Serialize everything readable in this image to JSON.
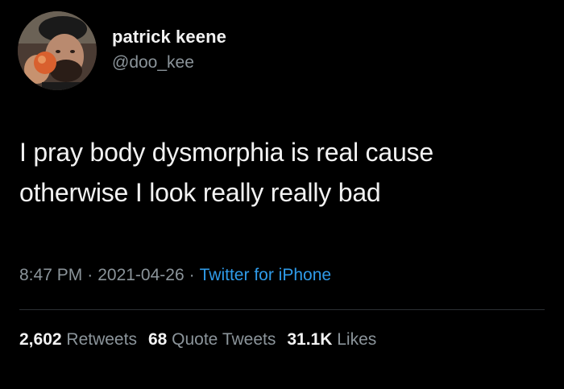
{
  "author": {
    "name": "patrick keene",
    "handle": "@doo_kee"
  },
  "tweet": {
    "text_line1": "I pray body dysmorphia is real cause",
    "text_line2": "otherwise I look really really bad"
  },
  "meta": {
    "time": "8:47 PM",
    "date": "2021-04-26",
    "separator": "·",
    "source": "Twitter for iPhone"
  },
  "stats": {
    "retweets_count": "2,602",
    "retweets_label": "Retweets",
    "quotes_count": "68",
    "quotes_label": "Quote Tweets",
    "likes_count": "31.1K",
    "likes_label": "Likes"
  },
  "colors": {
    "background": "#000000",
    "text": "#f2f2f2",
    "secondary": "#8b949a",
    "link": "#2f9be9"
  }
}
